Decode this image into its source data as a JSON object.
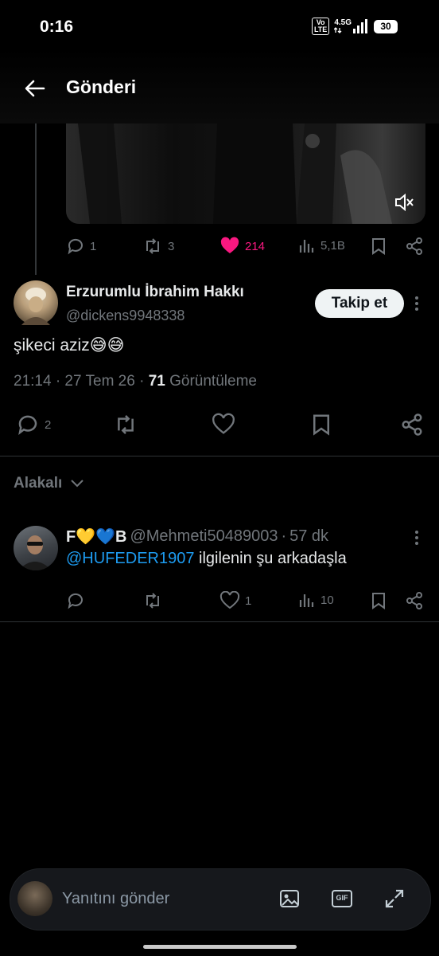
{
  "status_bar": {
    "time": "0:16",
    "volte_line1": "Vo",
    "volte_line2": "LTE",
    "network": "4.5G",
    "battery": "30"
  },
  "header": {
    "title": "Gönderi"
  },
  "prev_tweet_actions": {
    "replies": "1",
    "retweets": "3",
    "likes": "214",
    "views": "5,1B"
  },
  "main_tweet": {
    "author_name": "Erzurumlu İbrahim Hakkı",
    "author_handle": "@dickens9948338",
    "follow_label": "Takip et",
    "text": "şikeci aziz😅😅",
    "time": "21:14 · 27 Tem 26 · ",
    "views_count": "71",
    "views_label": " Görüntüleme",
    "reply_count": "2"
  },
  "related_label": "Alakalı",
  "reply": {
    "author_name": "F💛💙B",
    "author_handle": "@Mehmeti50489003",
    "sep": "·",
    "time": "57 dk",
    "mention": "@HUFEDER1907",
    "text": " ilgilenin şu arkadaşla",
    "likes": "1",
    "views": "10"
  },
  "composer": {
    "placeholder": "Yanıtını gönder",
    "gif_label": "GIF"
  },
  "colors": {
    "background": "#000000",
    "like_pink": "#f91880",
    "link_blue": "#1d9bf0",
    "muted": "#71767b"
  }
}
